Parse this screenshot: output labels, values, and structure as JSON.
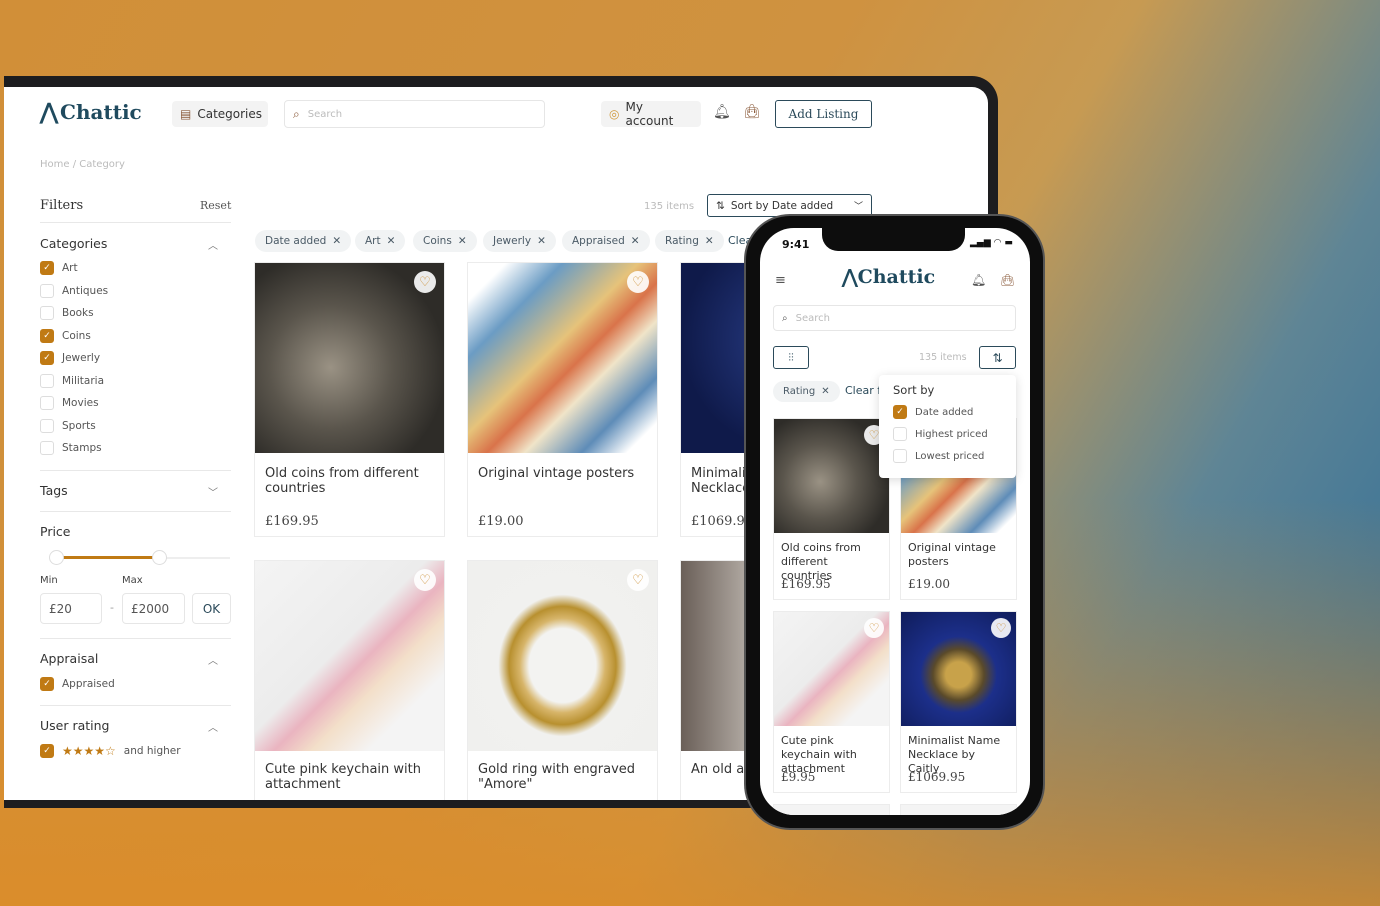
{
  "desktop": {
    "header": {
      "logo": "Chattic",
      "categories_label": "Categories",
      "search_placeholder": "Search",
      "account_label": "My account",
      "add_listing_label": "Add Listing"
    },
    "breadcrumb": "Home / Category",
    "filters": {
      "title": "Filters",
      "reset": "Reset",
      "categories": {
        "title": "Categories",
        "items": [
          {
            "label": "Art",
            "checked": true
          },
          {
            "label": "Antiques",
            "checked": false
          },
          {
            "label": "Books",
            "checked": false
          },
          {
            "label": "Coins",
            "checked": true
          },
          {
            "label": "Jewerly",
            "checked": true
          },
          {
            "label": "Militaria",
            "checked": false
          },
          {
            "label": "Movies",
            "checked": false
          },
          {
            "label": "Sports",
            "checked": false
          },
          {
            "label": "Stamps",
            "checked": false
          }
        ]
      },
      "tags": {
        "title": "Tags"
      },
      "price": {
        "title": "Price",
        "min_label": "Min",
        "max_label": "Max",
        "min": "£20",
        "max": "£2000",
        "separator": "-",
        "ok": "OK"
      },
      "appraisal": {
        "title": "Appraisal",
        "option": "Appraised",
        "checked": true
      },
      "rating": {
        "title": "User rating",
        "stars": "★★★★☆",
        "stars_value": 4,
        "suffix": "and higher",
        "checked": true
      }
    },
    "items_count": "135 items",
    "sort_label": "Sort by Date added",
    "chips": [
      "Date added",
      "Art",
      "Coins",
      "Jewerly",
      "Appraised",
      "Rating"
    ],
    "clear_label": "Clear",
    "products": [
      {
        "title": "Old coins from different countries",
        "price": "£169.95"
      },
      {
        "title": "Original vintage posters",
        "price": "£19.00"
      },
      {
        "title": "Minimalist Name Necklace by Caitly",
        "price": "£1069.95"
      },
      {
        "title": "Cute pink keychain with attachment",
        "price": ""
      },
      {
        "title": "Gold ring with engraved \"Amore\"",
        "price": ""
      },
      {
        "title": "An old a",
        "price": ""
      }
    ]
  },
  "mobile": {
    "time": "9:41",
    "logo": "Chattic",
    "search_placeholder": "Search",
    "items_count": "135 items",
    "chip": "Rating",
    "clear_label": "Clear f",
    "sort_menu": {
      "title": "Sort by",
      "options": [
        {
          "label": "Date added",
          "checked": true
        },
        {
          "label": "Highest priced",
          "checked": false
        },
        {
          "label": "Lowest priced",
          "checked": false
        }
      ]
    },
    "products": [
      {
        "title": "Old coins from different countries",
        "price": "£169.95"
      },
      {
        "title": "Original vintage posters",
        "price": "£19.00"
      },
      {
        "title": "Cute pink keychain with  attachment",
        "price": "£9.95"
      },
      {
        "title": "Minimalist Name Necklace by Caitly",
        "price": "£1069.95"
      }
    ]
  },
  "colors": {
    "accent": "#c07a14",
    "brand": "#1f4a5e"
  }
}
